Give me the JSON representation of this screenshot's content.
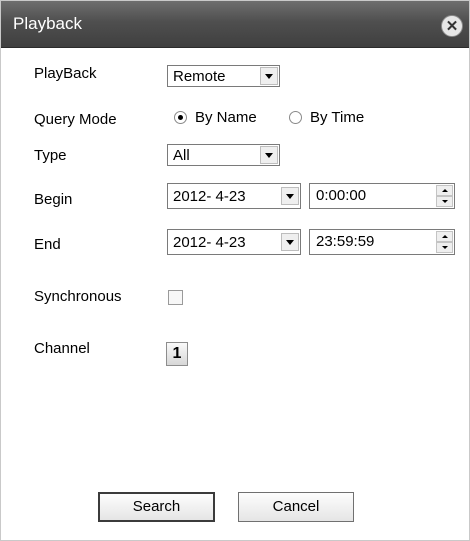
{
  "window": {
    "title": "Playback"
  },
  "form": {
    "playback": {
      "label": "PlayBack",
      "value": "Remote"
    },
    "query_mode": {
      "label": "Query Mode",
      "options": [
        "By Name",
        "By Time"
      ],
      "selected": "By Name"
    },
    "type": {
      "label": "Type",
      "value": "All"
    },
    "begin": {
      "label": "Begin",
      "date": "2012- 4-23",
      "time": "0:00:00"
    },
    "end": {
      "label": "End",
      "date": "2012- 4-23",
      "time": "23:59:59"
    },
    "synchronous": {
      "label": "Synchronous",
      "checked": false
    },
    "channel": {
      "label": "Channel",
      "value": "1"
    }
  },
  "buttons": {
    "search": "Search",
    "cancel": "Cancel"
  },
  "icons": {
    "close": "close-icon",
    "dropdown": "chevron-down-icon"
  }
}
